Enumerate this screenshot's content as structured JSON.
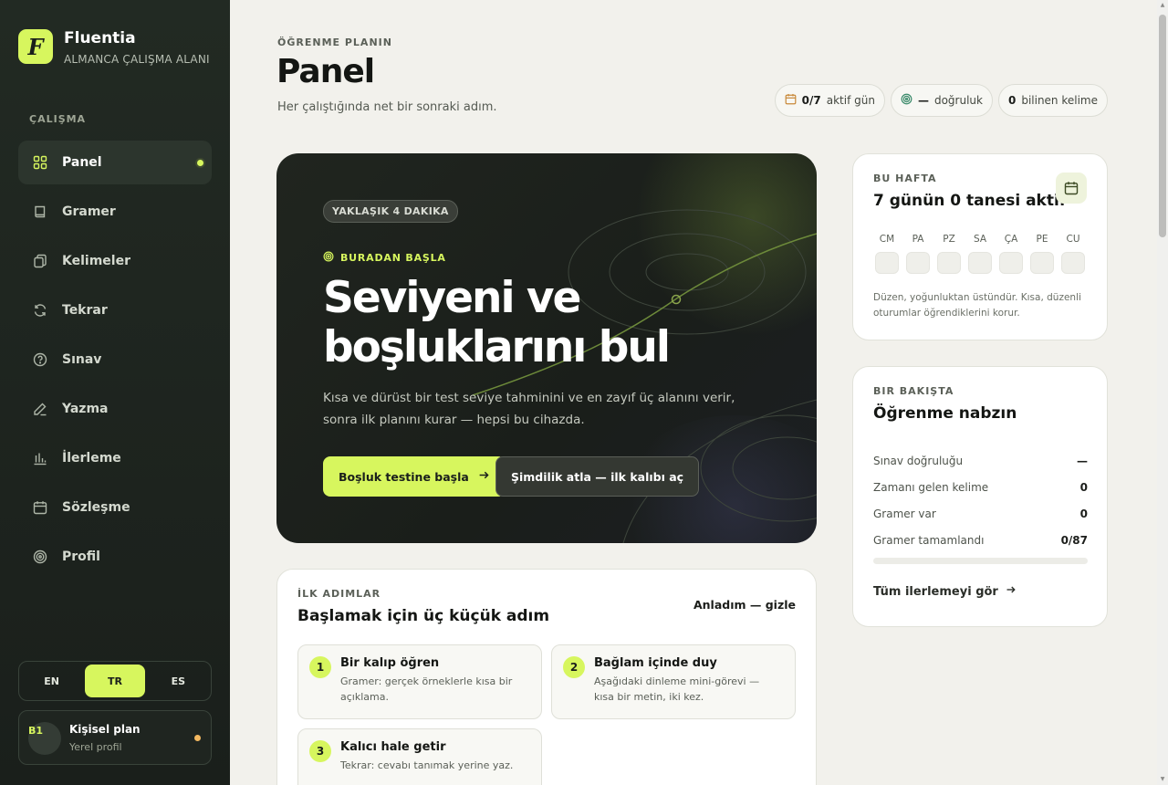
{
  "app": {
    "name": "Fluentia",
    "subtitle": "ALMANCA ÇALIŞMA ALANI",
    "logo_letter": "F",
    "accent_color": "#d7f65e"
  },
  "sidebar": {
    "section_label": "ÇALIŞMA",
    "items": [
      {
        "label": "Panel",
        "icon": "grid-icon",
        "active": true
      },
      {
        "label": "Gramer",
        "icon": "book-icon"
      },
      {
        "label": "Kelimeler",
        "icon": "cards-icon"
      },
      {
        "label": "Tekrar",
        "icon": "refresh-icon"
      },
      {
        "label": "Sınav",
        "icon": "help-circle-icon"
      },
      {
        "label": "Yazma",
        "icon": "pen-icon"
      },
      {
        "label": "İlerleme",
        "icon": "bar-chart-icon"
      },
      {
        "label": "Sözleşme",
        "icon": "calendar-icon"
      },
      {
        "label": "Profil",
        "icon": "target-icon"
      }
    ],
    "languages": [
      "EN",
      "TR",
      "ES"
    ],
    "active_language": "TR",
    "profile": {
      "level": "B1",
      "name": "Kişisel plan",
      "subtitle": "Yerel profil"
    }
  },
  "header": {
    "eyebrow": "ÖĞRENME PLANIN",
    "title": "Panel",
    "subtitle": "Her çalıştığında net bir sonraki adım.",
    "chips": [
      {
        "icon": "calendar-icon",
        "value": "0/7",
        "label": "aktif gün"
      },
      {
        "icon": "target-icon",
        "value": "—",
        "label": "doğruluk"
      },
      {
        "icon": "",
        "value": "0",
        "label": "bilinen kelime"
      }
    ]
  },
  "hero": {
    "badge": "YAKLAŞIK 4 DAKIKA",
    "kicker": "BURADAN BAŞLA",
    "title_line1": "Seviyeni ve",
    "title_line2": "boşluklarını bul",
    "description": "Kısa ve dürüst bir test seviye tahminini ve en zayıf üç alanını verir, sonra ilk planını kurar — hepsi bu cihazda.",
    "primary_button": "Boşluk testine başla",
    "secondary_button": "Şimdilik atla — ilk kalıbı aç"
  },
  "week": {
    "eyebrow": "BU HAFTA",
    "title": "7 günün 0 tanesi aktif",
    "days": [
      "CM",
      "PA",
      "PZ",
      "SA",
      "ÇA",
      "PE",
      "CU"
    ],
    "note": "Düzen, yoğunluktan üstündür. Kısa, düzenli oturumlar öğrendiklerini korur."
  },
  "pulse": {
    "eyebrow": "BIR BAKIŞTA",
    "title": "Öğrenme nabzın",
    "stats": [
      {
        "label": "Sınav doğruluğu",
        "value": "—"
      },
      {
        "label": "Zamanı gelen kelime",
        "value": "0"
      },
      {
        "label": "Gramer var",
        "value": "0"
      },
      {
        "label": "Gramer tamamlandı",
        "value": "0/87"
      }
    ],
    "progress_fraction": 0,
    "link": "Tüm ilerlemeyi gör"
  },
  "steps": {
    "eyebrow": "İLK ADIMLAR",
    "title": "Başlamak için üç küçük adım",
    "dismiss": "Anladım — gizle",
    "items": [
      {
        "num": "1",
        "title": "Bir kalıp öğren",
        "desc": "Gramer: gerçek örneklerle kısa bir açıklama."
      },
      {
        "num": "2",
        "title": "Bağlam içinde duy",
        "desc": "Aşağıdaki dinleme mini-görevi — kısa bir metin, iki kez."
      },
      {
        "num": "3",
        "title": "Kalıcı hale getir",
        "desc": "Tekrar: cevabı tanımak yerine yaz."
      }
    ]
  }
}
